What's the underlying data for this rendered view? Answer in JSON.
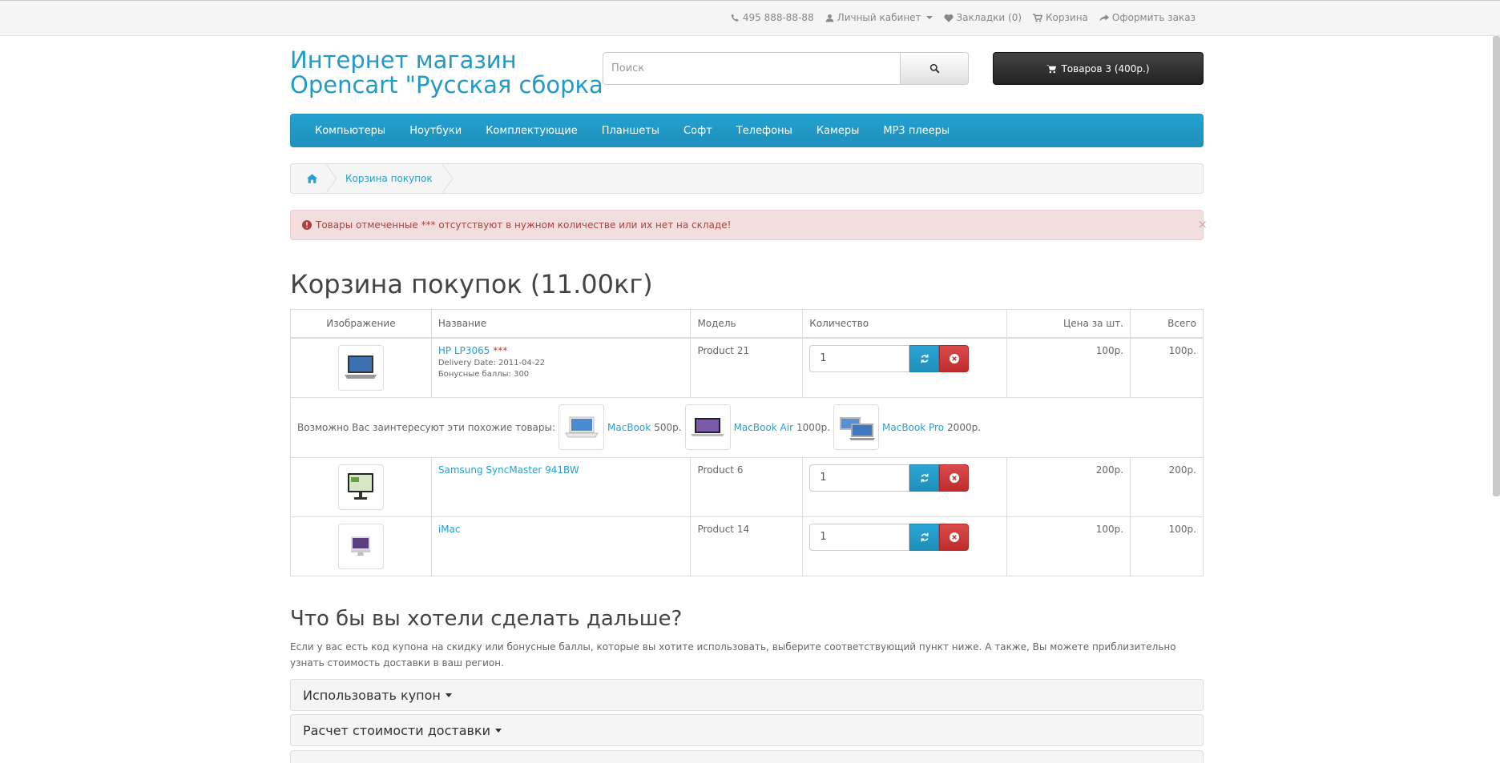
{
  "topbar": {
    "phone": "495 888-88-88",
    "account": "Личный кабинет",
    "wishlist": "Закладки (0)",
    "cart": "Корзина",
    "checkout": "Оформить заказ"
  },
  "header": {
    "logo_line1": "Интернет магазин",
    "logo_line2": "Opencart \"Русская сборка\"",
    "search_placeholder": "Поиск",
    "cart_button": "Товаров 3 (400р.)"
  },
  "menu": [
    "Компьютеры",
    "Ноутбуки",
    "Комплектующие",
    "Планшеты",
    "Софт",
    "Телефоны",
    "Камеры",
    "MP3 плееры"
  ],
  "breadcrumb": {
    "current": "Корзина покупок"
  },
  "alert": {
    "text": "Товары отмеченные *** отсутствуют в нужном количестве или их нет на складе!",
    "close": "×"
  },
  "page_title": "Корзина покупок  (11.00кг)",
  "table": {
    "headers": [
      "Изображение",
      "Название",
      "Модель",
      "Количество",
      "Цена за шт.",
      "Всего"
    ],
    "rows": [
      {
        "name": "HP LP3065",
        "stars": "***",
        "delivery": "Delivery Date: 2011-04-22",
        "bonus": "Бонусные баллы: 300",
        "model": "Product 21",
        "qty": "1",
        "price": "100р.",
        "total": "100р."
      },
      {
        "name": "Samsung SyncMaster 941BW",
        "model": "Product 6",
        "qty": "1",
        "price": "200р.",
        "total": "200р."
      },
      {
        "name": "iMac",
        "model": "Product 14",
        "qty": "1",
        "price": "100р.",
        "total": "100р."
      }
    ],
    "related": {
      "label": "Возможно Вас заинтересуют эти похожие товары:",
      "items": [
        {
          "name": "MacBook",
          "price": "500р."
        },
        {
          "name": "MacBook Air",
          "price": "1000р."
        },
        {
          "name": "MacBook Pro",
          "price": "2000р."
        }
      ]
    }
  },
  "next": {
    "title": "Что бы вы хотели сделать дальше?",
    "desc": "Если у вас есть код купона на скидку или бонусные баллы, которые вы хотите использовать, выберите соответствующий пункт ниже. А также, Вы можете приблизительно узнать стоимость доставки в ваш регион.",
    "panels": [
      "Использовать купон",
      "Расчет стоимости доставки"
    ]
  },
  "colors": {
    "accent": "#23a1d1",
    "danger": "#c02c2c",
    "dark": "#222222",
    "alert_bg": "#f2dede"
  }
}
